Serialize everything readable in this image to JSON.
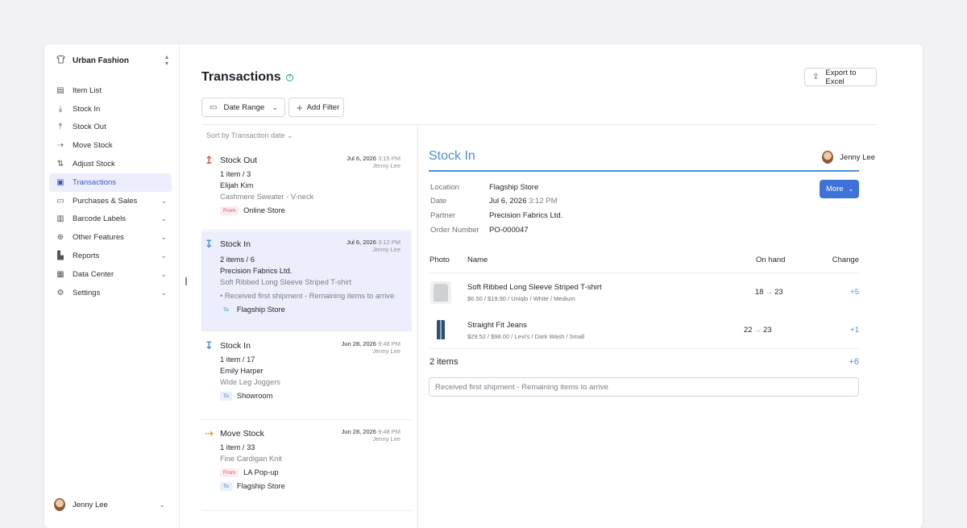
{
  "workspace": {
    "name": "Urban Fashion",
    "icon": "shirt-icon"
  },
  "sidebar": {
    "items": [
      {
        "label": "Item List",
        "icon": "list-box-icon"
      },
      {
        "label": "Stock In",
        "icon": "arrow-down-icon"
      },
      {
        "label": "Stock Out",
        "icon": "arrow-up-icon"
      },
      {
        "label": "Move Stock",
        "icon": "arrow-right-icon"
      },
      {
        "label": "Adjust Stock",
        "icon": "swap-icon"
      },
      {
        "label": "Transactions",
        "icon": "ledger-icon",
        "active": true
      },
      {
        "label": "Purchases & Sales",
        "icon": "document-icon",
        "expandable": true
      },
      {
        "label": "Barcode Labels",
        "icon": "barcode-icon",
        "expandable": true
      },
      {
        "label": "Other Features",
        "icon": "plus-circle-icon",
        "expandable": true
      },
      {
        "label": "Reports",
        "icon": "bar-chart-icon",
        "expandable": true
      },
      {
        "label": "Data Center",
        "icon": "database-icon",
        "expandable": true
      },
      {
        "label": "Settings",
        "icon": "gear-icon",
        "expandable": true
      }
    ],
    "user": "Jenny Lee"
  },
  "page": {
    "title": "Transactions",
    "export_label": "Export to Excel"
  },
  "filters": {
    "date_range_label": "Date Range",
    "add_filter_label": "Add Filter",
    "sort_label": "Sort by Transaction date"
  },
  "transactions": [
    {
      "type": "Stock Out",
      "icon_color": "#d9534f",
      "date": "Jul 6, 2026",
      "time": "3:15 PM",
      "user": "Jenny Lee",
      "qty": "1 item / 3",
      "partner": "Elijah Kim",
      "item": "Cashmere Sweater - V-neck",
      "from": "Online Store"
    },
    {
      "type": "Stock In",
      "icon_color": "#4a90d0",
      "date": "Jul 6, 2026",
      "time": "3:12 PM",
      "user": "Jenny Lee",
      "qty": "2 items / 6",
      "partner": "Precision Fabrics Ltd.",
      "item": "Soft Ribbed Long Sleeve Striped T-shirt",
      "note": "Received first shipment - Remaining items to arrive",
      "to": "Flagship Store"
    },
    {
      "type": "Stock In",
      "icon_color": "#4a90d0",
      "date": "Jun 28, 2026",
      "time": "9:48 PM",
      "user": "Jenny Lee",
      "qty": "1 item / 17",
      "partner": "Emily Harper",
      "item": "Wide Leg Joggers",
      "to": "Showroom"
    },
    {
      "type": "Move Stock",
      "icon_color": "#f0a020",
      "date": "Jun 28, 2026",
      "time": "9:48 PM",
      "user": "Jenny Lee",
      "qty": "1 item / 33",
      "item": "Fine Cardigan Knit",
      "from": "LA Pop-up",
      "to": "Flagship Store"
    }
  ],
  "tag_labels": {
    "from": "From",
    "to": "To"
  },
  "detail": {
    "title": "Stock In",
    "user": "Jenny Lee",
    "more_label": "More",
    "fields": [
      {
        "key": "Location",
        "value": "Flagship Store"
      },
      {
        "key": "Date",
        "value": "Jul 6, 2026",
        "time": "3:12 PM"
      },
      {
        "key": "Partner",
        "value": "Precision Fabrics Ltd."
      },
      {
        "key": "Order Number",
        "value": "PO-000047"
      }
    ],
    "columns": {
      "photo": "Photo",
      "name": "Name",
      "on_hand": "On hand",
      "change": "Change"
    },
    "items": [
      {
        "name": "Soft Ribbed Long Sleeve Striped T-shirt",
        "meta": "$6.50 / $19.90 / Uniqlo / White / Medium",
        "from": "18",
        "to": "23",
        "change": "+5"
      },
      {
        "name": "Straight Fit Jeans",
        "meta": "$29.52 / $98.00 / Levi's / Dark Wash / Small",
        "from": "22",
        "to": "23",
        "change": "+1"
      }
    ],
    "total_label": "2 items",
    "total_change": "+6",
    "note": "Received first shipment - Remaining items to arrive"
  },
  "colors": {
    "accent": "#3d73d9",
    "stock_in": "#4a90d0",
    "stock_out": "#d9534f",
    "move": "#f0a020",
    "active_bg": "#eceefb"
  }
}
